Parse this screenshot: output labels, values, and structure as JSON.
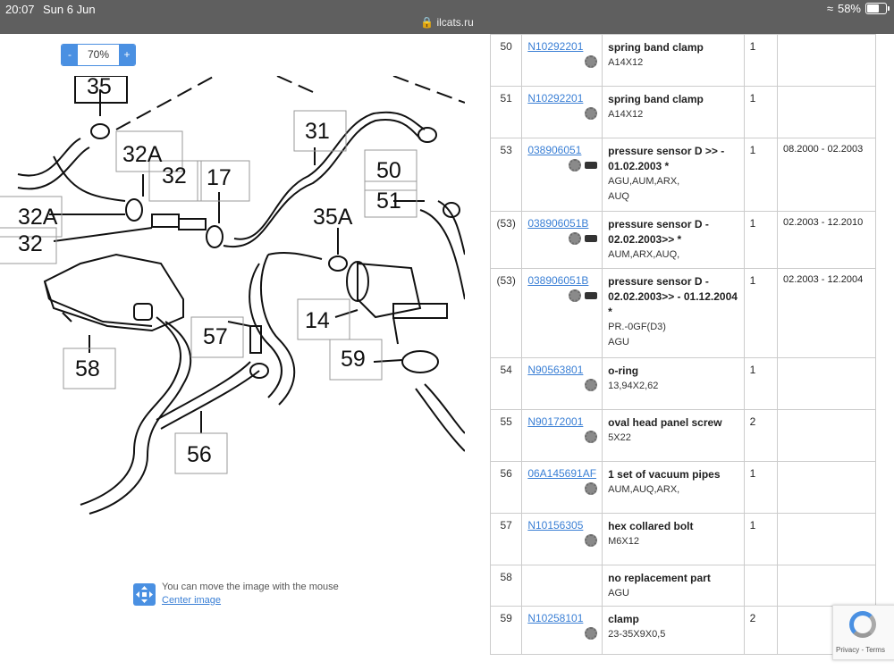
{
  "status": {
    "time": "20:07",
    "date": "Sun 6 Jun",
    "battery": "58%",
    "url": "ilcats.ru",
    "battery_level": 0.58
  },
  "zoom": {
    "minus": "-",
    "value": "70%",
    "plus": "+"
  },
  "diagram": {
    "labels": [
      "35",
      "31",
      "32A",
      "32",
      "17",
      "50",
      "51",
      "32A",
      "32",
      "35A",
      "14",
      "57",
      "58",
      "59",
      "56"
    ]
  },
  "hint": {
    "text": "You can move the image with the mouse",
    "link": "Center image"
  },
  "parts": [
    {
      "pos": "50",
      "number": "N10292201",
      "name": "spring band clamp",
      "sub": [
        "A14X12"
      ],
      "qty": "1",
      "date": ""
    },
    {
      "pos": "51",
      "number": "N10292201",
      "name": "spring band clamp",
      "sub": [
        "A14X12"
      ],
      "qty": "1",
      "date": ""
    },
    {
      "pos": "53",
      "number": "038906051",
      "name": "pressure sensor D >> - 01.02.2003 *",
      "sub": [
        "AGU,AUM,ARX,",
        "AUQ"
      ],
      "qty": "1",
      "date": "08.2000 - 02.2003"
    },
    {
      "pos": "(53)",
      "number": "038906051B",
      "name": "pressure sensor D - 02.02.2003>> *",
      "sub": [
        "AUM,ARX,AUQ,"
      ],
      "qty": "1",
      "date": "02.2003 - 12.2010"
    },
    {
      "pos": "(53)",
      "number": "038906051B",
      "name": "pressure sensor D - 02.02.2003>> - 01.12.2004 *",
      "sub": [
        "PR.-0GF(D3)",
        "AGU"
      ],
      "qty": "1",
      "date": "02.2003 - 12.2004"
    },
    {
      "pos": "54",
      "number": "N90563801",
      "name": "o-ring",
      "sub": [
        "13,94X2,62"
      ],
      "qty": "1",
      "date": ""
    },
    {
      "pos": "55",
      "number": "N90172001",
      "name": "oval head panel screw",
      "sub": [
        "5X22"
      ],
      "qty": "2",
      "date": ""
    },
    {
      "pos": "56",
      "number": "06A145691AF",
      "name": "1 set of vacuum pipes",
      "sub": [
        "AUM,AUQ,ARX,"
      ],
      "qty": "1",
      "date": ""
    },
    {
      "pos": "57",
      "number": "N10156305",
      "name": "hex collared bolt",
      "sub": [
        "M6X12"
      ],
      "qty": "1",
      "date": ""
    },
    {
      "pos": "58",
      "number": "",
      "name": "no replacement part",
      "sub": [
        "AGU"
      ],
      "qty": "",
      "date": ""
    },
    {
      "pos": "59",
      "number": "N10258101",
      "name": "clamp",
      "sub": [
        "23-35X9X0,5"
      ],
      "qty": "2",
      "date": ""
    }
  ],
  "recaptcha": {
    "text": "Privacy - Terms"
  }
}
